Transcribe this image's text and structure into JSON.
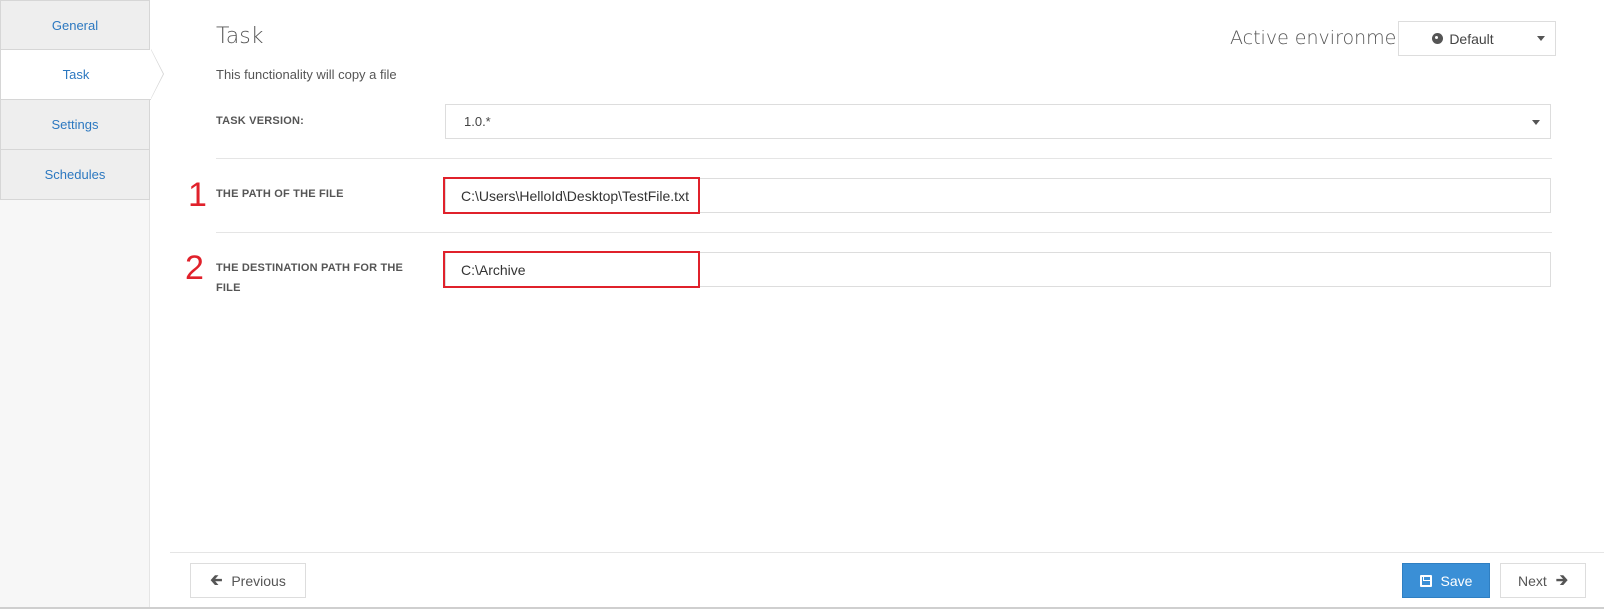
{
  "sidebar": {
    "items": [
      {
        "label": "General"
      },
      {
        "label": "Task"
      },
      {
        "label": "Settings"
      },
      {
        "label": "Schedules"
      }
    ],
    "active_index": 1
  },
  "header": {
    "title": "Task",
    "description": "This functionality will copy a file",
    "env_label": "Active environment",
    "env_value": "Default",
    "env_icon": "globe-icon"
  },
  "form": {
    "task_version_label": "TASK VERSION:",
    "task_version_value": "1.0.*",
    "file_path_label": "THE PATH OF THE FILE",
    "file_path_value": "C:\\Users\\HelloId\\Desktop\\TestFile.txt",
    "destination_label": "THE DESTINATION PATH FOR THE FILE",
    "destination_value": "C:\\Archive"
  },
  "annotations": {
    "marker_1": "1",
    "marker_2": "2",
    "color": "#e0212b"
  },
  "footer": {
    "previous_label": "Previous",
    "save_label": "Save",
    "next_label": "Next",
    "save_color": "#3a8fd6"
  }
}
